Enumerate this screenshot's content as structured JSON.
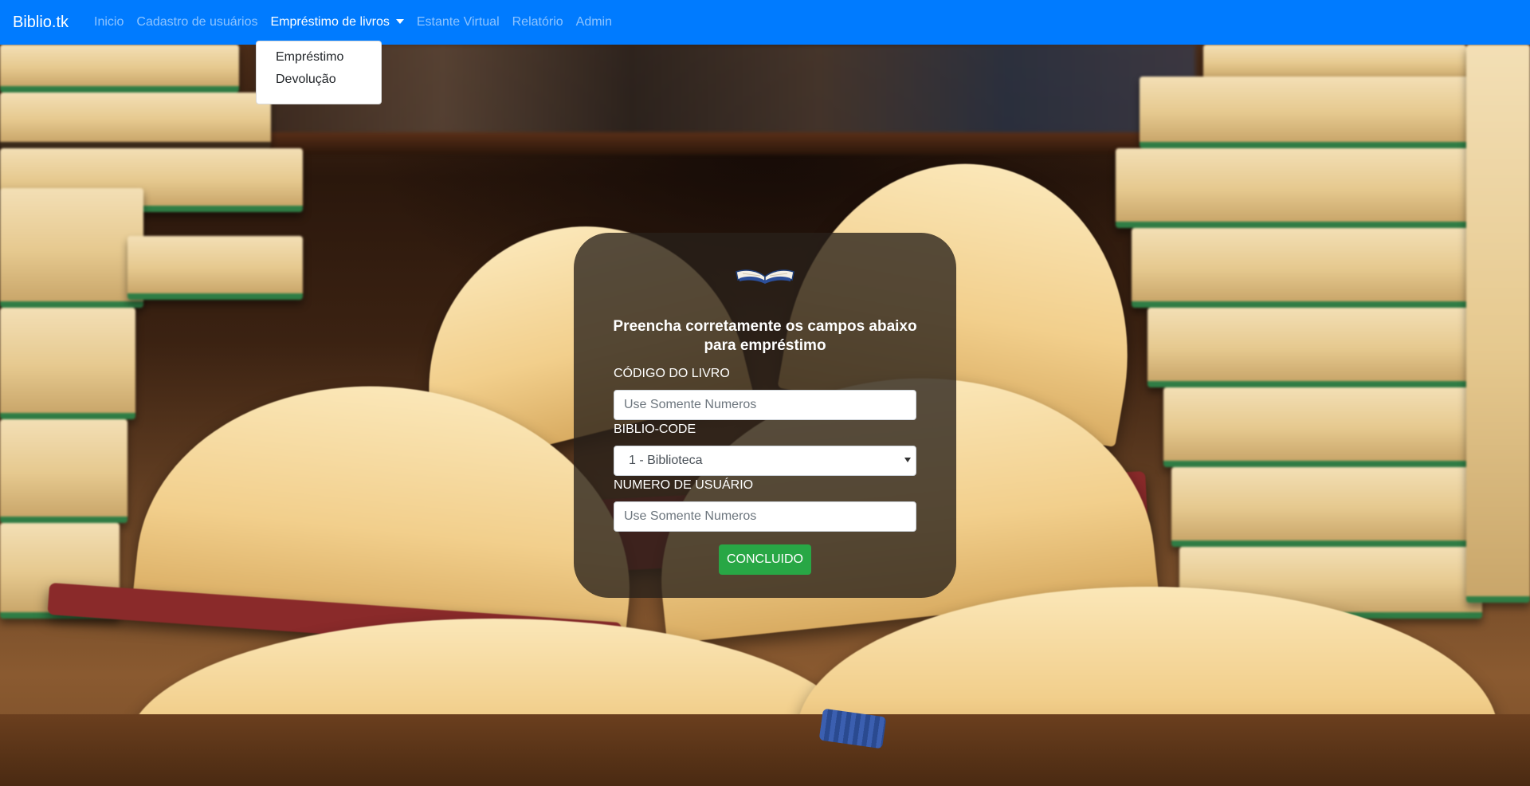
{
  "navbar": {
    "brand": "Biblio.tk",
    "items": [
      {
        "label": "Inicio"
      },
      {
        "label": "Cadastro de usuários"
      },
      {
        "label": "Empréstimo de livros"
      },
      {
        "label": "Estante Virtual"
      },
      {
        "label": "Relatório"
      },
      {
        "label": "Admin"
      }
    ],
    "active_index": 2,
    "color": "#007bff"
  },
  "dropdown": {
    "items": [
      {
        "label": "Empréstimo"
      },
      {
        "label": "Devolução"
      }
    ]
  },
  "form": {
    "icon": "open-book-icon",
    "title_line1": "Preencha corretamente os campos abaixo",
    "title_line2": "para empréstimo",
    "book_code": {
      "label": "CÓDIGO DO LIVRO",
      "placeholder": "Use Somente Numeros",
      "value": ""
    },
    "biblio_code": {
      "label": "BIBLIO-CODE",
      "selected": "1 - Biblioteca"
    },
    "user_number": {
      "label": "NUMERO DE USUÁRIO",
      "placeholder": "Use Somente Numeros",
      "value": ""
    },
    "submit_label": "CONCLUIDO",
    "submit_color": "#28a745"
  }
}
